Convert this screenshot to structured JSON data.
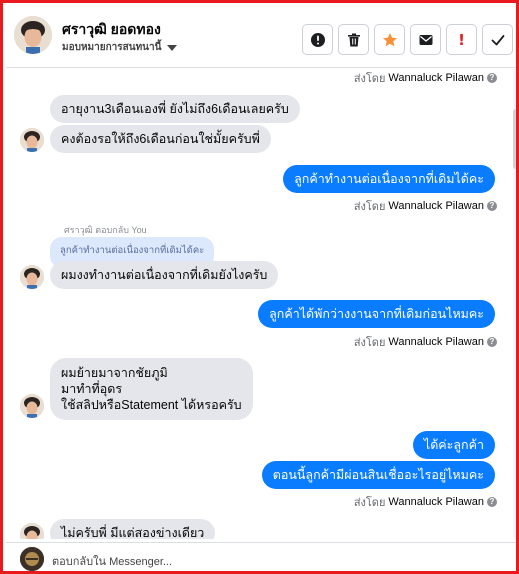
{
  "header": {
    "name": "ศราวุฒิ ยอดทอง",
    "assign_label": "มอบหมายการสนทนานี้",
    "actions": [
      {
        "name": "mark-spam-button",
        "icon": "alert-circle-icon"
      },
      {
        "name": "delete-button",
        "icon": "trash-icon"
      },
      {
        "name": "star-button",
        "icon": "star-icon"
      },
      {
        "name": "mark-unread-button",
        "icon": "envelope-icon"
      },
      {
        "name": "follow-up-button",
        "icon": "exclamation-icon",
        "glyph": "!"
      },
      {
        "name": "mark-done-button",
        "icon": "check-icon"
      }
    ],
    "star_color": "#f7923b",
    "alert_color": "#e02020"
  },
  "thread": {
    "sent_prefix": "ส่งโดย",
    "agent": "Wannaluck Pilawan",
    "info_glyph": "?",
    "messages": {
      "m1": "อายุงาน3เดือนเองพี่ ยังไม่ถึง6เดือนเลยครับ",
      "m2": "คงต้องรอให้ถึง6เดือนก่อนใช่มั้ยครับพี่",
      "m3": "ลูกค้าทำงานต่อเนื่องจากที่เดิมได้คะ",
      "reply_label": "ศราวุฒิ ตอบกลับ You",
      "quote": "ลูกค้าทำงานต่อเนื่องจากที่เดิมได้คะ",
      "m4": "ผมงงทำงานต่อเนื่องจากที่เดิมยังไงครับ",
      "m5": "ลูกค้าได้พักว่างงานจากที่เดิมก่อนไหมคะ",
      "m6_line1": "ผมย้ายมาจากชัยภูมิ",
      "m6_line2": "มาทำที่อุดร",
      "m6_line3": "ใช้สลิปหรือStatement ได้หรอครับ",
      "m7": "ได้ค่ะลูกค้า",
      "m8": "ตอนนี้ลูกค้ามีผ่อนสินเชื่ออะไรอยู่ไหมคะ",
      "m9": "ไม่ครับพี่ มีแต่สองข่างเดียว"
    },
    "outgoing_color": "#0a7cff",
    "incoming_color": "#e4e6eb"
  },
  "composer": {
    "placeholder": "ตอบกลับใน Messenger..."
  },
  "frame_color": "#e8191f"
}
